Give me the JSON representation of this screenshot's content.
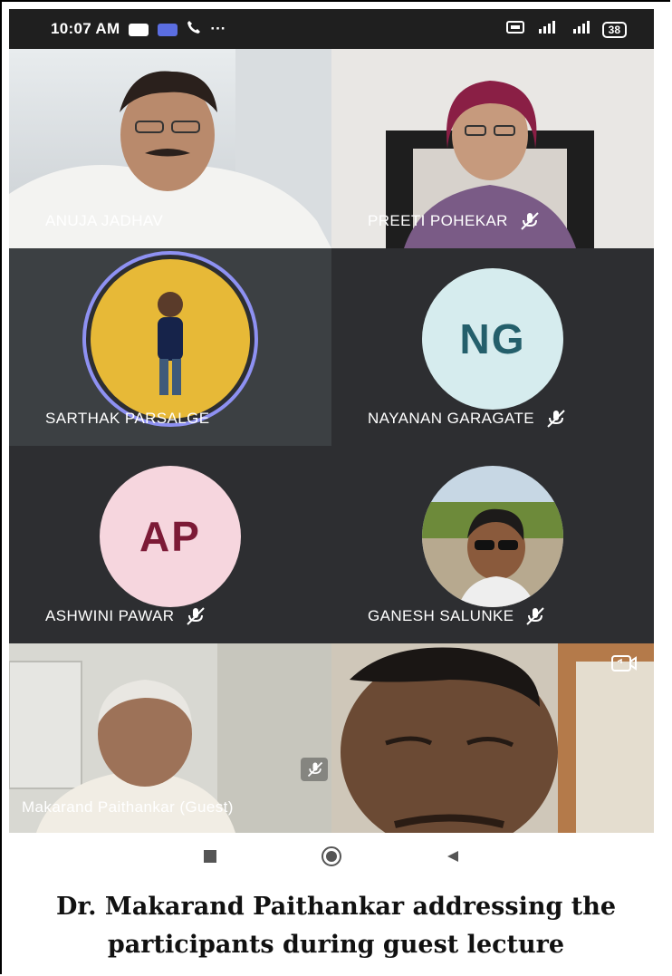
{
  "status_bar": {
    "time": "10:07 AM",
    "dots": "···",
    "battery": "38"
  },
  "participants": [
    {
      "name": "ANUJA JADHAV",
      "muted": false,
      "kind": "video"
    },
    {
      "name": "PREETI POHEKAR",
      "muted": true,
      "kind": "video"
    },
    {
      "name": "SARTHAK PARSALGE",
      "muted": false,
      "kind": "photo-avatar"
    },
    {
      "name": "NAYANAN GARAGATE",
      "muted": true,
      "kind": "initials",
      "initials": "NG",
      "avatar_color": "#d6ecee",
      "initials_color": "#245f6b"
    },
    {
      "name": "ASHWINI PAWAR",
      "muted": true,
      "kind": "initials",
      "initials": "AP",
      "avatar_color": "#f6d6de",
      "initials_color": "#7c1a36"
    },
    {
      "name": "GANESH SALUNKE",
      "muted": true,
      "kind": "photo-avatar"
    },
    {
      "name": "Makarand Paithankar (Guest)",
      "muted": true,
      "kind": "video"
    },
    {
      "name": "",
      "muted": false,
      "kind": "self-video"
    }
  ],
  "controls": {
    "switch_camera_icon": "switch-camera-icon"
  },
  "nav_bar": {
    "recent": "square-icon",
    "home": "circle-icon",
    "back": "triangle-back-icon"
  },
  "caption": {
    "line1": "Dr. Makarand Paithankar addressing the",
    "line2": "participants during guest lecture"
  }
}
